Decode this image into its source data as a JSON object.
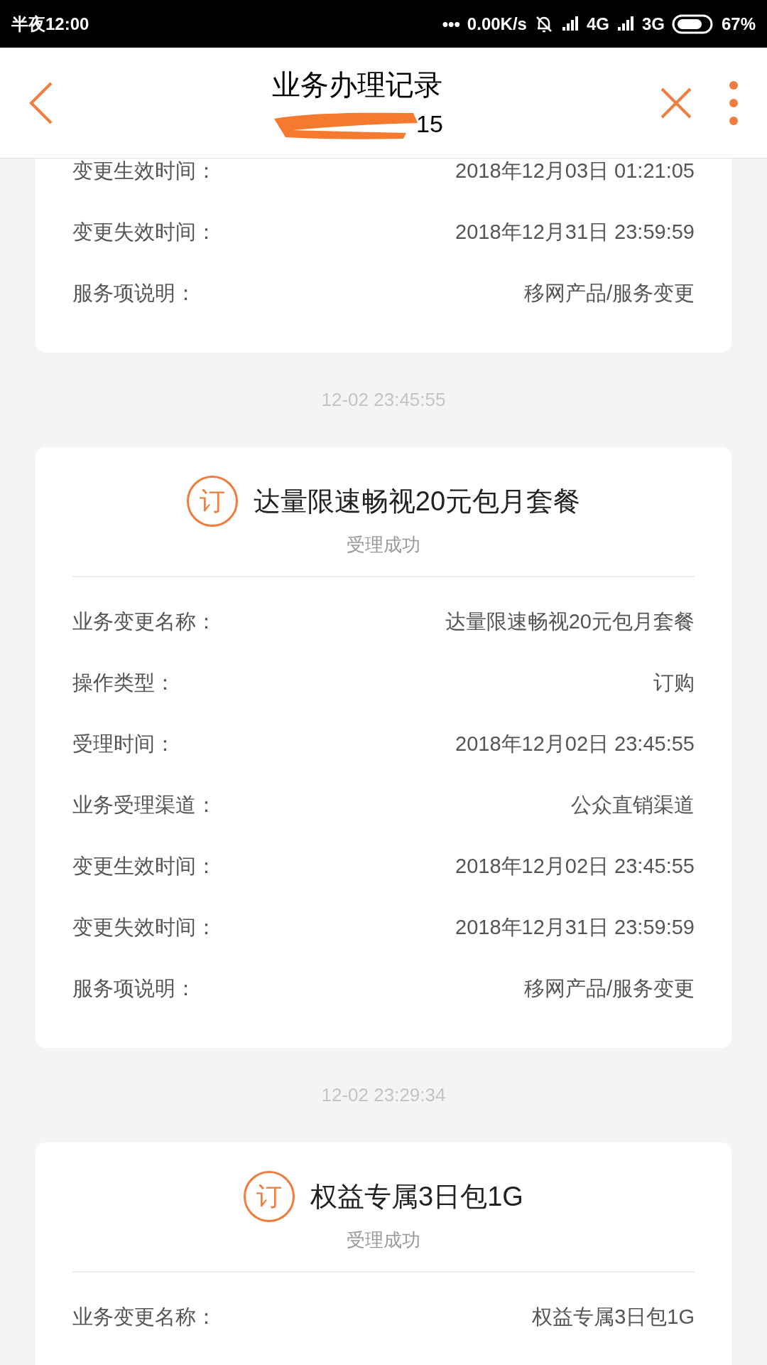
{
  "status_bar": {
    "time": "半夜12:00",
    "dots": "•••",
    "net_speed": "0.00K/s",
    "network_1": "4G",
    "network_2": "3G",
    "battery": "67%"
  },
  "header": {
    "title": "业务办理记录",
    "subtitle": "15"
  },
  "records": [
    {
      "fields": [
        {
          "label": "变更生效时间：",
          "value": "2018年12月03日 01:21:05"
        },
        {
          "label": "变更失效时间：",
          "value": "2018年12月31日 23:59:59"
        },
        {
          "label": "服务项说明：",
          "value": "移网产品/服务变更"
        }
      ]
    },
    {
      "timestamp": "12-02 23:45:55",
      "badge": "订",
      "title": "达量限速畅视20元包月套餐",
      "status": "受理成功",
      "fields": [
        {
          "label": "业务变更名称：",
          "value": "达量限速畅视20元包月套餐"
        },
        {
          "label": "操作类型：",
          "value": "订购"
        },
        {
          "label": "受理时间：",
          "value": "2018年12月02日 23:45:55"
        },
        {
          "label": "业务受理渠道：",
          "value": "公众直销渠道"
        },
        {
          "label": "变更生效时间：",
          "value": "2018年12月02日 23:45:55"
        },
        {
          "label": "变更失效时间：",
          "value": "2018年12月31日 23:59:59"
        },
        {
          "label": "服务项说明：",
          "value": "移网产品/服务变更"
        }
      ]
    },
    {
      "timestamp": "12-02 23:29:34",
      "badge": "订",
      "title": "权益专属3日包1G",
      "status": "受理成功",
      "fields": [
        {
          "label": "业务变更名称：",
          "value": "权益专属3日包1G"
        }
      ]
    }
  ]
}
